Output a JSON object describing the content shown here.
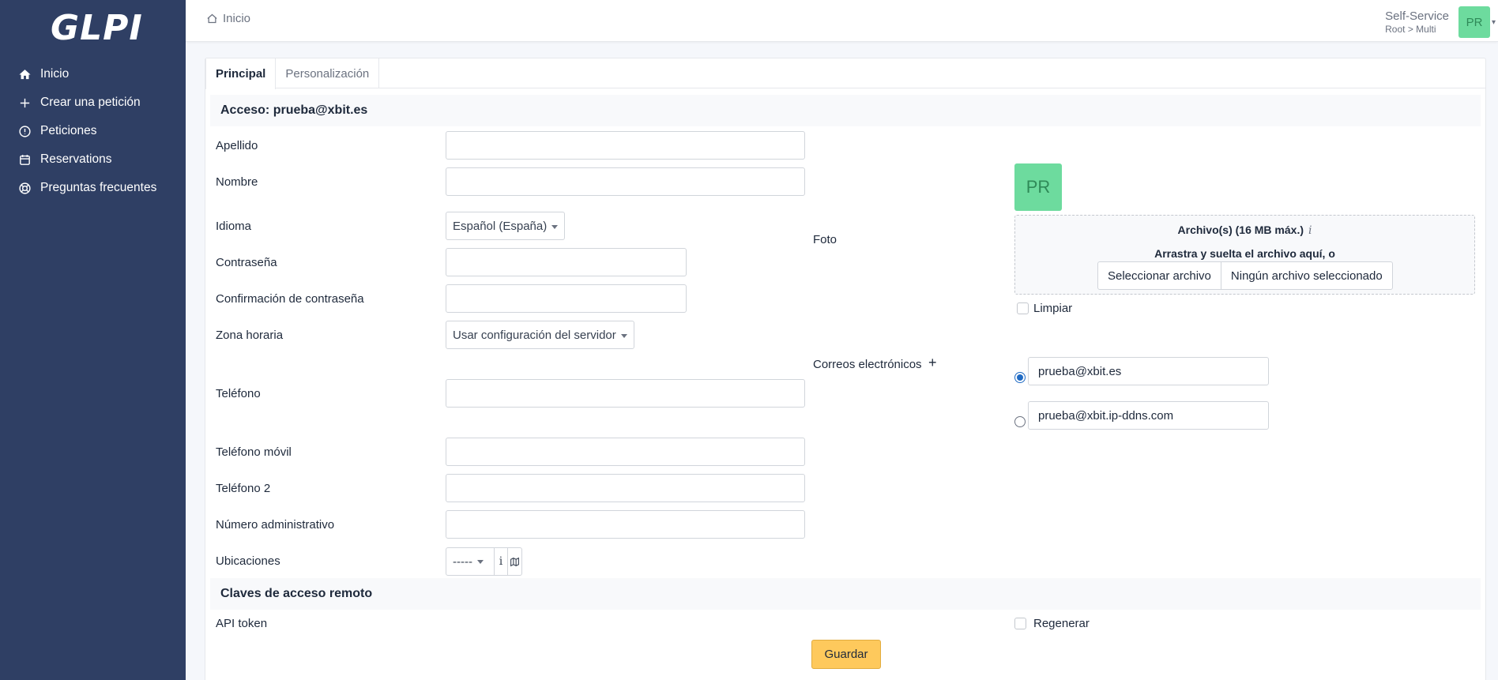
{
  "app": {
    "logo_text": "GLPI"
  },
  "sidebar": {
    "items": [
      {
        "label": "Inicio",
        "icon": "home-icon"
      },
      {
        "label": "Crear una petición",
        "icon": "plus-icon"
      },
      {
        "label": "Peticiones",
        "icon": "alert-circle-icon"
      },
      {
        "label": "Reservations",
        "icon": "calendar-icon"
      },
      {
        "label": "Preguntas frecuentes",
        "icon": "lifebuoy-icon"
      }
    ]
  },
  "header": {
    "breadcrumb": "Inicio",
    "profile_name": "Self-Service",
    "profile_entity": "Root > Multi",
    "avatar_initials": "PR"
  },
  "tabs": [
    {
      "label": "Principal",
      "active": true
    },
    {
      "label": "Personalización",
      "active": false
    }
  ],
  "form": {
    "section_title": "Acceso: prueba@xbit.es",
    "labels": {
      "apellido": "Apellido",
      "nombre": "Nombre",
      "idioma": "Idioma",
      "contrasena": "Contraseña",
      "confirmacion": "Confirmación de contraseña",
      "zona": "Zona horaria",
      "telefono": "Teléfono",
      "movil": "Teléfono móvil",
      "telefono2": "Teléfono 2",
      "numero_admin": "Número administrativo",
      "ubicaciones": "Ubicaciones",
      "foto": "Foto",
      "correos": "Correos electrónicos",
      "limpiar": "Limpiar"
    },
    "values": {
      "apellido": "",
      "nombre": "",
      "idioma": "Español (España)",
      "contrasena": "",
      "confirmacion": "",
      "zona": "Usar configuración del servidor",
      "telefono": "",
      "movil": "",
      "telefono2": "",
      "numero_admin": "",
      "ubicaciones": "-----"
    },
    "photo": {
      "avatar_initials": "PR",
      "dropzone_title": "Archivo(s) (16 MB máx.)",
      "dropzone_info": "i",
      "dropzone_sub": "Arrastra y suelta el archivo aquí, o",
      "select_button": "Seleccionar archivo",
      "no_file": "Ningún archivo seleccionado"
    },
    "emails": [
      {
        "value": "prueba@xbit.es",
        "default": true
      },
      {
        "value": "prueba@xbit.ip-ddns.com",
        "default": false
      }
    ],
    "emails_add": "+",
    "location_info": "i",
    "remote_section_title": "Claves de acceso remoto",
    "api_token_label": "API token",
    "regenerate_label": "Regenerar",
    "save_label": "Guardar"
  },
  "colors": {
    "sidebar_bg": "#2f3f64",
    "avatar_bg": "#6ddb9e",
    "save_button": "#fec95c",
    "radio_active": "#206bc4"
  }
}
